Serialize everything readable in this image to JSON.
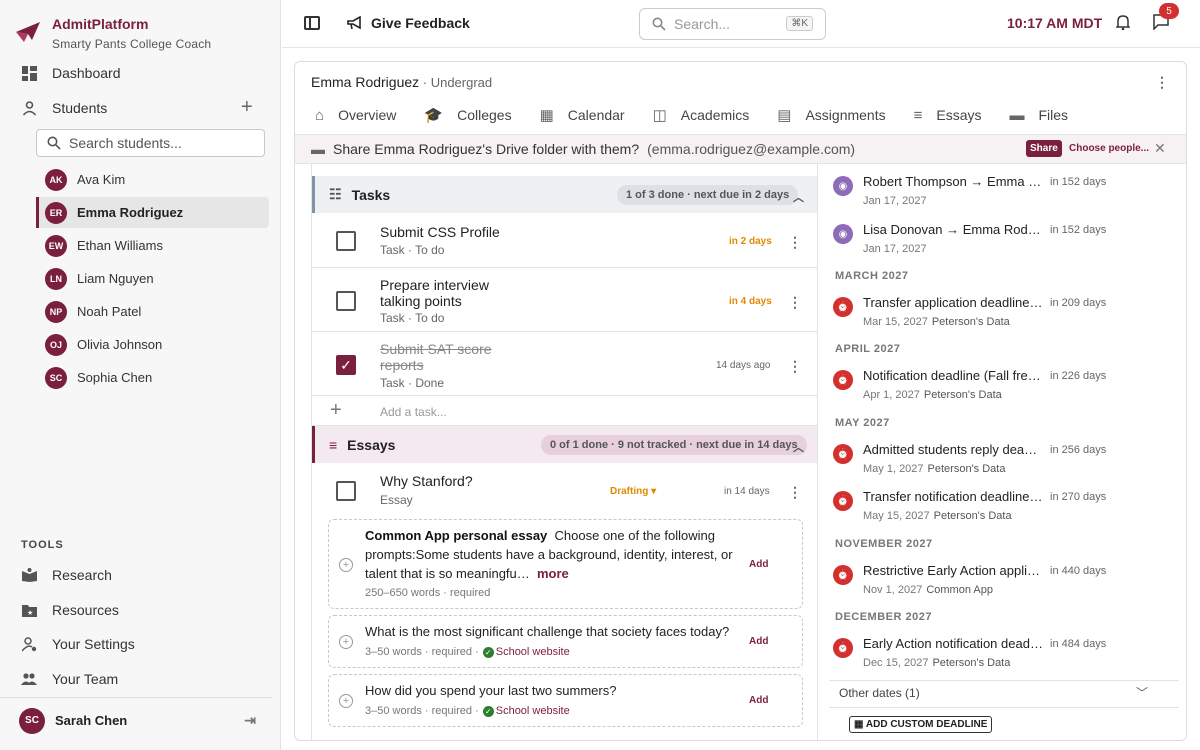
{
  "brand": {
    "name": "AdmitPlatform",
    "tagline": "Smarty Pants College Coach"
  },
  "nav": {
    "dashboard": "Dashboard",
    "students": "Students",
    "search_placeholder": "Search students...",
    "students_list": [
      {
        "initials": "AK",
        "name": "Ava Kim"
      },
      {
        "initials": "ER",
        "name": "Emma Rodriguez"
      },
      {
        "initials": "EW",
        "name": "Ethan Williams"
      },
      {
        "initials": "LN",
        "name": "Liam Nguyen"
      },
      {
        "initials": "NP",
        "name": "Noah Patel"
      },
      {
        "initials": "OJ",
        "name": "Olivia Johnson"
      },
      {
        "initials": "SC",
        "name": "Sophia Chen"
      }
    ],
    "tools_heading": "TOOLS",
    "tools": [
      "Research",
      "Resources",
      "Your Settings",
      "Your Team"
    ],
    "user": {
      "initials": "SC",
      "name": "Sarah Chen"
    }
  },
  "topbar": {
    "feedback": "Give Feedback",
    "search_placeholder": "Search...",
    "shortcut": "⌘K",
    "time": "10:17 AM MDT",
    "notification_count": "5"
  },
  "student": {
    "name": "Emma Rodriguez",
    "level": " · Undergrad"
  },
  "tabs": [
    "Overview",
    "Colleges",
    "Calendar",
    "Academics",
    "Assignments",
    "Essays",
    "Files"
  ],
  "share_bar": {
    "text": "Share Emma Rodriguez's Drive folder with them?",
    "email": "(emma.rodriguez@example.com)",
    "share_label": "Share",
    "choose_label": "Choose people..."
  },
  "tasks": {
    "heading": "Tasks",
    "summary": "1 of 3 done · next due in 2 days",
    "items": [
      {
        "title": "Submit CSS Profile",
        "meta": "Task · To do",
        "due": "in 2 days"
      },
      {
        "title": "Prepare interview talking points",
        "meta": "Task · To do",
        "due": "in 4 days"
      },
      {
        "title": "Submit SAT score reports",
        "meta": "Task · Done",
        "due": "14 days ago"
      }
    ],
    "add_placeholder": "Add a task..."
  },
  "essays": {
    "heading": "Essays",
    "summary": "0 of 1 done · 9 not tracked · next due in 14 days",
    "item": {
      "title": "Why Stanford?",
      "meta": "Essay",
      "status": "Drafting",
      "due": "in 14 days"
    },
    "prompts": [
      {
        "title": "Common App personal essay",
        "text": "Choose one of the following prompts:Some students have a background, identity, interest, or talent that is so meaningfu…",
        "more": "more",
        "meta": "250–650 words · required",
        "source": "",
        "add": "Add"
      },
      {
        "title": "",
        "text": "What is the most significant challenge that society faces today?",
        "more": "",
        "meta": "3–50 words · required ·",
        "source": "School website",
        "add": "Add"
      },
      {
        "title": "",
        "text": "How did you spend your last two summers?",
        "more": "",
        "meta": "3–50 words · required ·",
        "source": "School website",
        "add": "Add"
      }
    ]
  },
  "timeline": {
    "events": [
      {
        "title": "Robert Thompson → Emma Ro...",
        "date": "Jan 17, 2027",
        "source": "",
        "due": "in 152 days",
        "kind": "purple"
      },
      {
        "title": "Lisa Donovan → Emma Rodrigu...",
        "date": "Jan 17, 2027",
        "source": "",
        "due": "in 152 days",
        "kind": "purple"
      }
    ],
    "months": [
      {
        "label": "MARCH 2027",
        "events": [
          {
            "title": "Transfer application deadline (F...",
            "date": "Mar 15, 2027",
            "source": "Peterson's Data",
            "due": "in 209 days"
          }
        ]
      },
      {
        "label": "APRIL 2027",
        "events": [
          {
            "title": "Notification deadline (Fall fresh...",
            "date": "Apr 1, 2027",
            "source": "Peterson's Data",
            "due": "in 226 days"
          }
        ]
      },
      {
        "label": "MAY 2027",
        "events": [
          {
            "title": "Admitted students reply deadline",
            "date": "May 1, 2027",
            "source": "Peterson's Data",
            "due": "in 256 days"
          },
          {
            "title": "Transfer notification deadline (...",
            "date": "May 15, 2027",
            "source": "Peterson's Data",
            "due": "in 270 days"
          }
        ]
      },
      {
        "label": "NOVEMBER 2027",
        "events": [
          {
            "title": "Restrictive Early Action applica...",
            "date": "Nov 1, 2027",
            "source": "Common App",
            "due": "in 440 days"
          }
        ]
      },
      {
        "label": "DECEMBER 2027",
        "events": [
          {
            "title": "Early Action notification deadline",
            "date": "Dec 15, 2027",
            "source": "Peterson's Data",
            "due": "in 484 days"
          }
        ]
      }
    ],
    "other_dates": "Other dates (1)",
    "add_custom": "ADD CUSTOM DEADLINE"
  }
}
